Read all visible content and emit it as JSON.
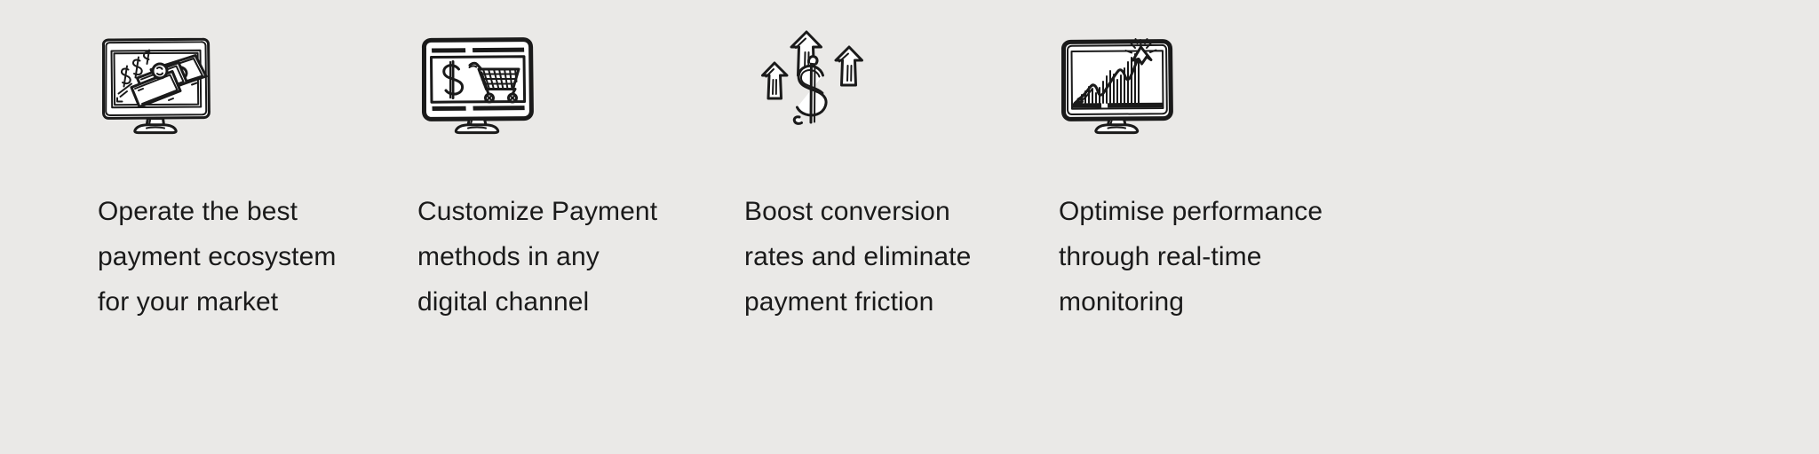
{
  "page": {
    "background_color": "#eae9e7",
    "text_color": "#1a1a1a",
    "ink_color": "#1a1a1a"
  },
  "features": [
    {
      "icon_name": "monitor-with-money-icon",
      "icon_description": "computer monitor displaying cash banknotes and dollar signs",
      "text": "Operate the best\npayment ecosystem\nfor your market",
      "lines": [
        "Operate the best",
        "payment ecosystem",
        "for your market"
      ]
    },
    {
      "icon_name": "monitor-with-shopping-cart-icon",
      "icon_description": "computer monitor displaying a dollar sign and a shopping cart",
      "text": "Customize Payment\nmethods in any\ndigital channel",
      "lines": [
        "Customize Payment",
        "methods in any",
        "digital channel"
      ]
    },
    {
      "icon_name": "dollar-sign-with-up-arrows-icon",
      "icon_description": "large dollar sign surrounded by three upward pointing arrows",
      "text": "Boost conversion\nrates and eliminate\npayment friction",
      "lines": [
        "Boost conversion",
        "rates and eliminate",
        "payment friction"
      ]
    },
    {
      "icon_name": "monitor-with-growth-chart-icon",
      "icon_description": "computer monitor displaying a rising line chart with an arrow bursting out of the top",
      "text": "Optimise performance\nthrough real-time\nmonitoring",
      "lines": [
        "Optimise performance",
        "through real-time",
        "monitoring"
      ]
    }
  ]
}
